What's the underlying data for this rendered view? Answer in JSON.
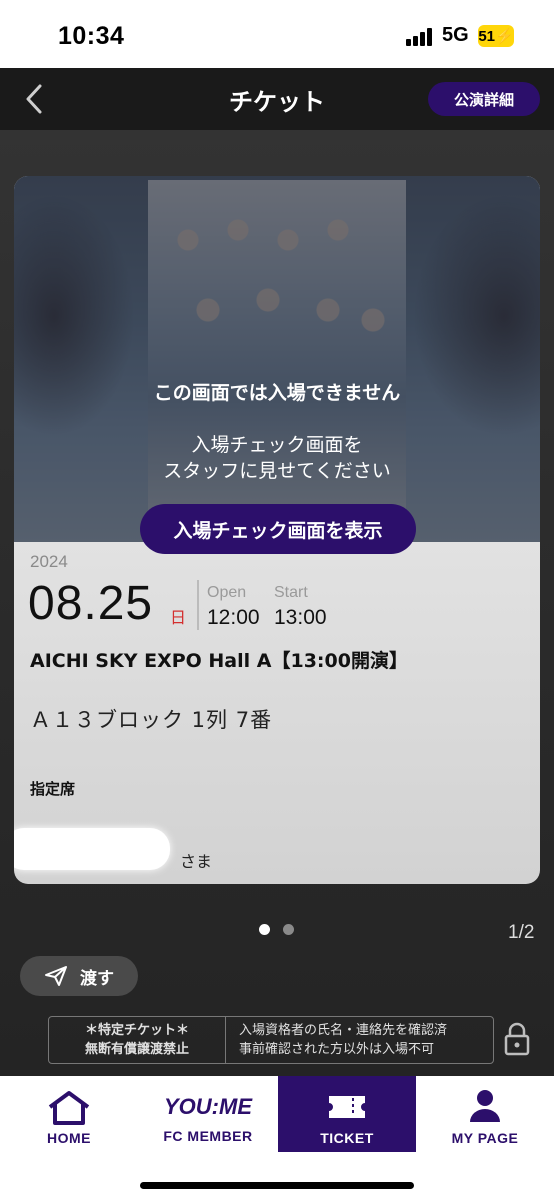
{
  "status_bar": {
    "time": "10:34",
    "network": "5G",
    "battery": "51"
  },
  "header": {
    "title": "チケット",
    "detail_button": "公演詳細"
  },
  "ticket": {
    "notice_title": "この画面では入場できません",
    "notice_line1": "入場チェック画面を",
    "notice_line2": "スタッフに見せてください",
    "entry_button": "入場チェック画面を表示",
    "year": "2024",
    "date": "08.25",
    "weekday": "日",
    "open_label": "Open",
    "start_label": "Start",
    "open_time": "12:00",
    "start_time": "13:00",
    "venue": "AICHI SKY EXPO Hall A【13:00開演】",
    "seat": "Ａ１３ブロック 1列 7番",
    "seat_type": "指定席",
    "honorific": "さま"
  },
  "pager": {
    "count": "1/2",
    "active_index": 0
  },
  "transfer_button": "渡す",
  "rules": {
    "left_line1": "＊特定チケット＊",
    "left_line2": "無断有償譲渡禁止",
    "right_line1": "入場資格者の氏名・連絡先を確認済",
    "right_line2": "事前確認された方以外は入場不可"
  },
  "tabbar": {
    "items": [
      {
        "label": "HOME"
      },
      {
        "label": "FC MEMBER",
        "logo": "YOU:ME"
      },
      {
        "label": "TICKET"
      },
      {
        "label": "MY PAGE"
      }
    ]
  },
  "colors": {
    "accent": "#2c0f6b",
    "weekday": "#d32f2f",
    "battery": "#ffd60a"
  }
}
